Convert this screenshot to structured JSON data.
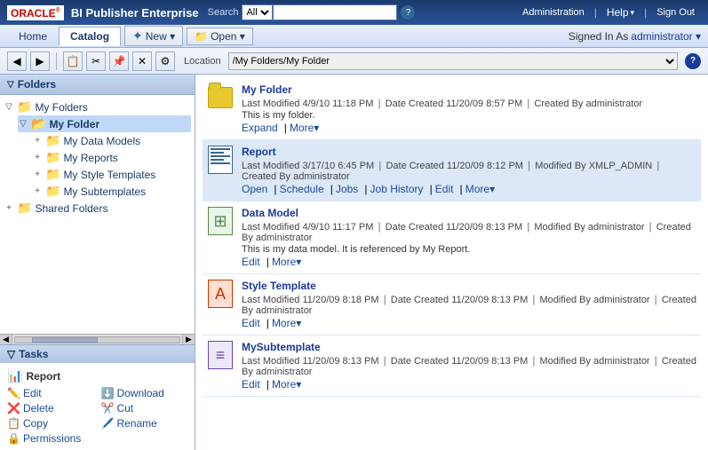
{
  "topbar": {
    "oracle_text": "ORACLE",
    "app_title": "BI Publisher Enterprise",
    "search_label": "Search",
    "search_option": "All",
    "admin_label": "Administration",
    "help_label": "Help",
    "signout_label": "Sign Out"
  },
  "navbar": {
    "home_label": "Home",
    "catalog_label": "Catalog",
    "new_label": "New ▾",
    "open_label": "Open ▾",
    "signed_in_label": "Signed In As",
    "user_label": "administrator ▾"
  },
  "locationbar": {
    "location_label": "Location",
    "path_value": "/My Folders/My Folder"
  },
  "sidebar": {
    "folders_label": "Folders",
    "my_folders_label": "My Folders",
    "my_folder_label": "My Folder",
    "data_models_label": "My Data Models",
    "reports_label": "My Reports",
    "style_templates_label": "My Style Templates",
    "subtemplates_label": "My Subtemplates",
    "shared_folders_label": "Shared Folders"
  },
  "tasks": {
    "header_label": "Tasks",
    "section_label": "Report",
    "edit_label": "Edit",
    "delete_label": "Delete",
    "copy_label": "Copy",
    "permissions_label": "Permissions",
    "download_label": "Download",
    "cut_label": "Cut",
    "rename_label": "Rename"
  },
  "items": [
    {
      "name": "My Folder",
      "type": "folder",
      "meta": "Last Modified 4/9/10 11:18 PM | Date Created 11/20/09 8:57 PM | Created By administrator",
      "desc": "This is my folder.",
      "actions": [
        "Expand",
        "More▾"
      ]
    },
    {
      "name": "Report",
      "type": "report",
      "meta": "Last Modified 3/17/10 6:45 PM | Date Created 11/20/09 8:12 PM | Modified By XMLP_ADMIN | Created By administrator",
      "desc": "",
      "actions": [
        "Open",
        "Schedule",
        "Jobs",
        "Job History",
        "Edit",
        "More▾"
      ],
      "highlighted": true
    },
    {
      "name": "Data Model",
      "type": "datamodel",
      "meta": "Last Modified 4/9/10 11:17 PM | Date Created 11/20/09 8:13 PM | Modified By administrator | Created By administrator",
      "desc": "This is my data model. It is referenced by My Report.",
      "actions": [
        "Edit",
        "More▾"
      ]
    },
    {
      "name": "Style Template",
      "type": "styletemplate",
      "meta": "Last Modified 11/20/09 8:18 PM | Date Created 11/20/09 8:13 PM | Modified By administrator | Created By administrator",
      "desc": "",
      "actions": [
        "Edit",
        "More▾"
      ]
    },
    {
      "name": "MySubtemplate",
      "type": "subtemplate",
      "meta": "Last Modified 11/20/09 8:13 PM | Date Created 11/20/09 8:13 PM | Modified By administrator | Created By administrator",
      "desc": "",
      "actions": [
        "Edit",
        "More▾"
      ]
    }
  ]
}
